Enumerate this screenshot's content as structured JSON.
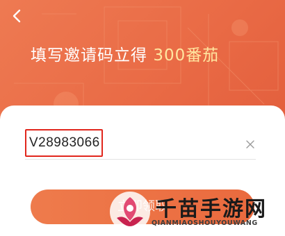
{
  "colors": {
    "hero_gradient_start": "#ee7a52",
    "hero_gradient_end": "#e35f3d",
    "reward_highlight": "#ffe6a0",
    "code_box_border": "#e1261c",
    "submit_button": "#ea6a3e"
  },
  "header": {
    "back_icon": "chevron-left-icon",
    "headline_prefix": "填写邀请码立得",
    "headline_reward": "300番茄"
  },
  "form": {
    "invite_code_value": "V28983066",
    "clear_icon": "close-icon",
    "submit_label": "立即领取"
  },
  "watermark": {
    "logo_icon": "qianmiao-logo",
    "title": "千苗手游网",
    "subtitle": "QIANMIAOSHOUYOUWANG"
  }
}
